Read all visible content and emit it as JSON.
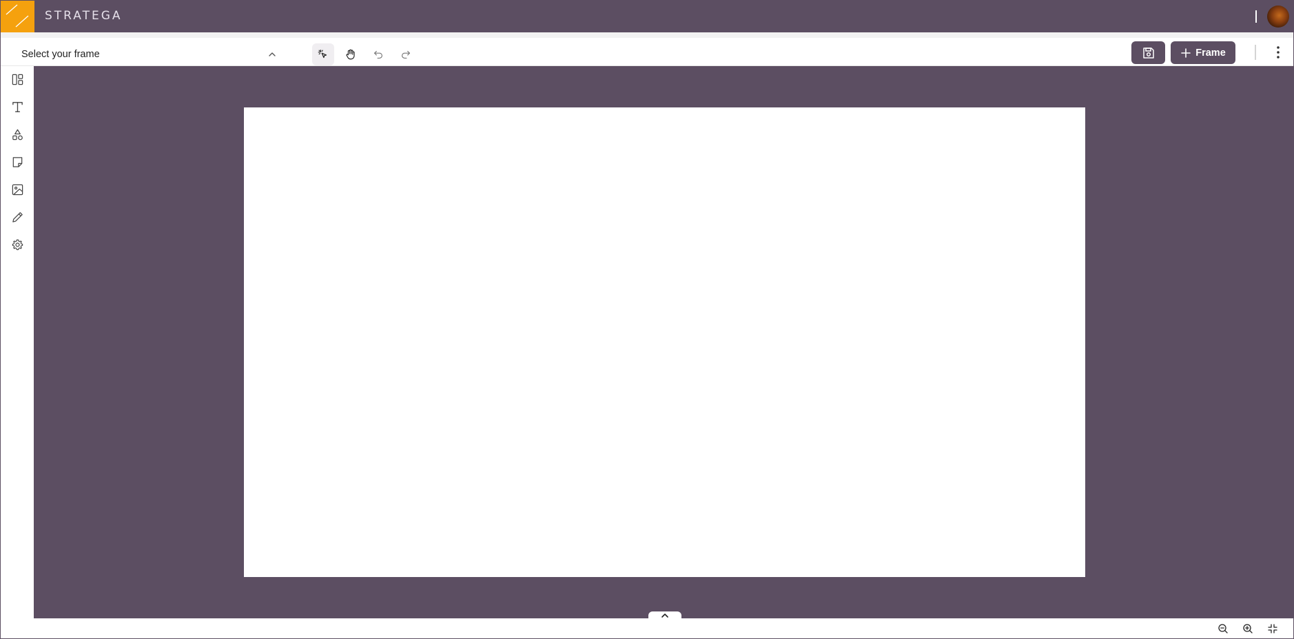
{
  "app": {
    "brand": "STRATEGA",
    "accent_color": "#f5a10e",
    "primary_color": "#5c4e62"
  },
  "header": {
    "logo_icon": "slash-logo-icon",
    "avatar_icon": "user-avatar"
  },
  "toolbar": {
    "frame_select_label": "Select your frame",
    "frame_select_icon": "chevron-up-icon",
    "tools": [
      {
        "name": "select-tool",
        "icon": "pointer-sparkle-icon",
        "active": true
      },
      {
        "name": "pan-tool",
        "icon": "hand-icon",
        "active": false
      },
      {
        "name": "undo",
        "icon": "undo-icon",
        "active": false
      },
      {
        "name": "redo",
        "icon": "redo-icon",
        "active": false
      }
    ],
    "save_icon": "save-icon",
    "add_frame_label": "Frame",
    "more_icon": "more-vertical-icon"
  },
  "sidebar": {
    "items": [
      {
        "name": "layout",
        "icon": "layout-icon"
      },
      {
        "name": "text",
        "icon": "text-icon"
      },
      {
        "name": "shapes",
        "icon": "shapes-icon"
      },
      {
        "name": "sticky-note",
        "icon": "sticky-note-icon"
      },
      {
        "name": "image",
        "icon": "image-icon"
      },
      {
        "name": "draw",
        "icon": "pencil-icon"
      },
      {
        "name": "settings",
        "icon": "gear-icon"
      }
    ]
  },
  "bottombar": {
    "zoom_out_icon": "zoom-out-icon",
    "zoom_in_icon": "zoom-in-icon",
    "fit_icon": "minimize-icon"
  }
}
